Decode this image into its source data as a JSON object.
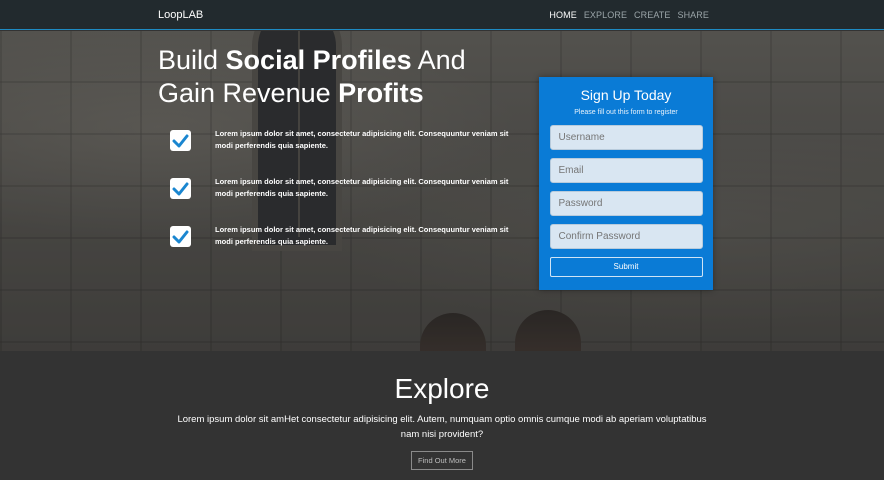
{
  "brand": "LoopLAB",
  "nav": {
    "items": [
      "HOME",
      "EXPLORE",
      "CREATE",
      "SHARE"
    ],
    "active": "HOME"
  },
  "hero": {
    "headline_line1_a": "Build ",
    "headline_line1_b": "Social Profiles",
    "headline_line1_c": " And",
    "headline_line2_a": "Gain Revenue ",
    "headline_line2_b": "Profits",
    "features": [
      "Lorem ipsum dolor sit amet, consectetur adipisicing elit. Consequuntur veniam sit modi perferendis quia sapiente.",
      "Lorem ipsum dolor sit amet, consectetur adipisicing elit. Consequuntur veniam sit modi perferendis quia sapiente.",
      "Lorem ipsum dolor sit amet, consectetur adipisicing elit. Consequuntur veniam sit modi perferendis quia sapiente."
    ]
  },
  "signup": {
    "title": "Sign Up Today",
    "subtitle": "Please fill out this form to register",
    "username_placeholder": "Username",
    "email_placeholder": "Email",
    "password_placeholder": "Password",
    "confirm_placeholder": "Confirm Password",
    "submit_label": "Submit"
  },
  "explore": {
    "title": "Explore",
    "text": "Lorem ipsum dolor sit amHet consectetur adipisicing elit. Autem, numquam optio omnis cumque modi ab aperiam voluptatibus nam nisi provident?",
    "button": "Find Out More"
  },
  "colors": {
    "accent": "#0a7bd6",
    "navbar": "#222a2e",
    "section_bg": "#333333",
    "checkmark": "#1a86d0"
  }
}
